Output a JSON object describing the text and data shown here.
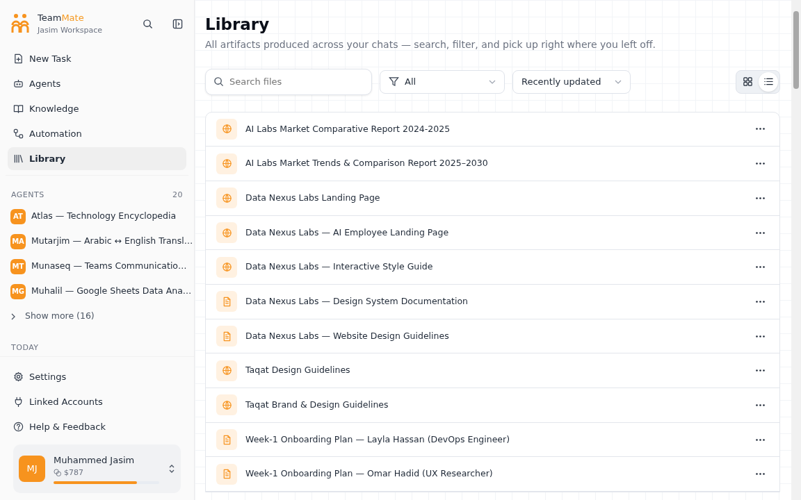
{
  "brand": {
    "name_first": "Team",
    "name_second": "Mate",
    "workspace": "Jasim Workspace"
  },
  "nav": [
    {
      "label": "New Task",
      "kind": "new",
      "selected": false
    },
    {
      "label": "Agents",
      "kind": "bot",
      "selected": false
    },
    {
      "label": "Knowledge",
      "kind": "book",
      "selected": false
    },
    {
      "label": "Automation",
      "kind": "flow",
      "selected": false
    },
    {
      "label": "Library",
      "kind": "library",
      "selected": true
    }
  ],
  "agents": {
    "heading": "AGENTS",
    "count": "20",
    "items": [
      {
        "initials": "AT",
        "name": "Atlas — Technology Encyclopedia"
      },
      {
        "initials": "MA",
        "name": "Mutarjim — Arabic ↔ English Transl…"
      },
      {
        "initials": "MT",
        "name": "Munaseq — Teams Communicatio…"
      },
      {
        "initials": "MG",
        "name": "Muhalil — Google Sheets Data Ana…"
      }
    ],
    "show_more": "Show more (16)"
  },
  "today_heading": "TODAY",
  "footer_nav": [
    {
      "label": "Settings",
      "kind": "gear"
    },
    {
      "label": "Linked Accounts",
      "kind": "plug"
    },
    {
      "label": "Help & Feedback",
      "kind": "help"
    }
  ],
  "user": {
    "initials": "MJ",
    "name": "Muhammed Jasim",
    "credits": "$787",
    "level": 0.79
  },
  "page": {
    "title": "Library",
    "subtitle": "All artifacts produced across your chats — search, filter, and pick up right where you left off."
  },
  "search": {
    "placeholder": "Search files"
  },
  "filter": {
    "value": "All"
  },
  "sort": {
    "value": "Recently updated"
  },
  "views": [
    {
      "kind": "grid",
      "selected": false
    },
    {
      "kind": "list",
      "selected": true
    }
  ],
  "files": [
    {
      "kind": "web",
      "title": "AI Labs Market Comparative Report 2024-2025"
    },
    {
      "kind": "web",
      "title": "AI Labs Market Trends & Comparison Report 2025–2030"
    },
    {
      "kind": "web",
      "title": "Data Nexus Labs Landing Page"
    },
    {
      "kind": "web",
      "title": "Data Nexus Labs — AI Employee Landing Page"
    },
    {
      "kind": "web",
      "title": "Data Nexus Labs — Interactive Style Guide"
    },
    {
      "kind": "doc",
      "title": "Data Nexus Labs — Design System Documentation"
    },
    {
      "kind": "doc",
      "title": "Data Nexus Labs — Website Design Guidelines"
    },
    {
      "kind": "web",
      "title": "Taqat Design Guidelines"
    },
    {
      "kind": "web",
      "title": "Taqat Brand & Design Guidelines"
    },
    {
      "kind": "doc",
      "title": "Week-1 Onboarding Plan — Layla Hassan (DevOps Engineer)"
    },
    {
      "kind": "doc",
      "title": "Week-1 Onboarding Plan — Omar Hadid (UX Researcher)"
    }
  ]
}
